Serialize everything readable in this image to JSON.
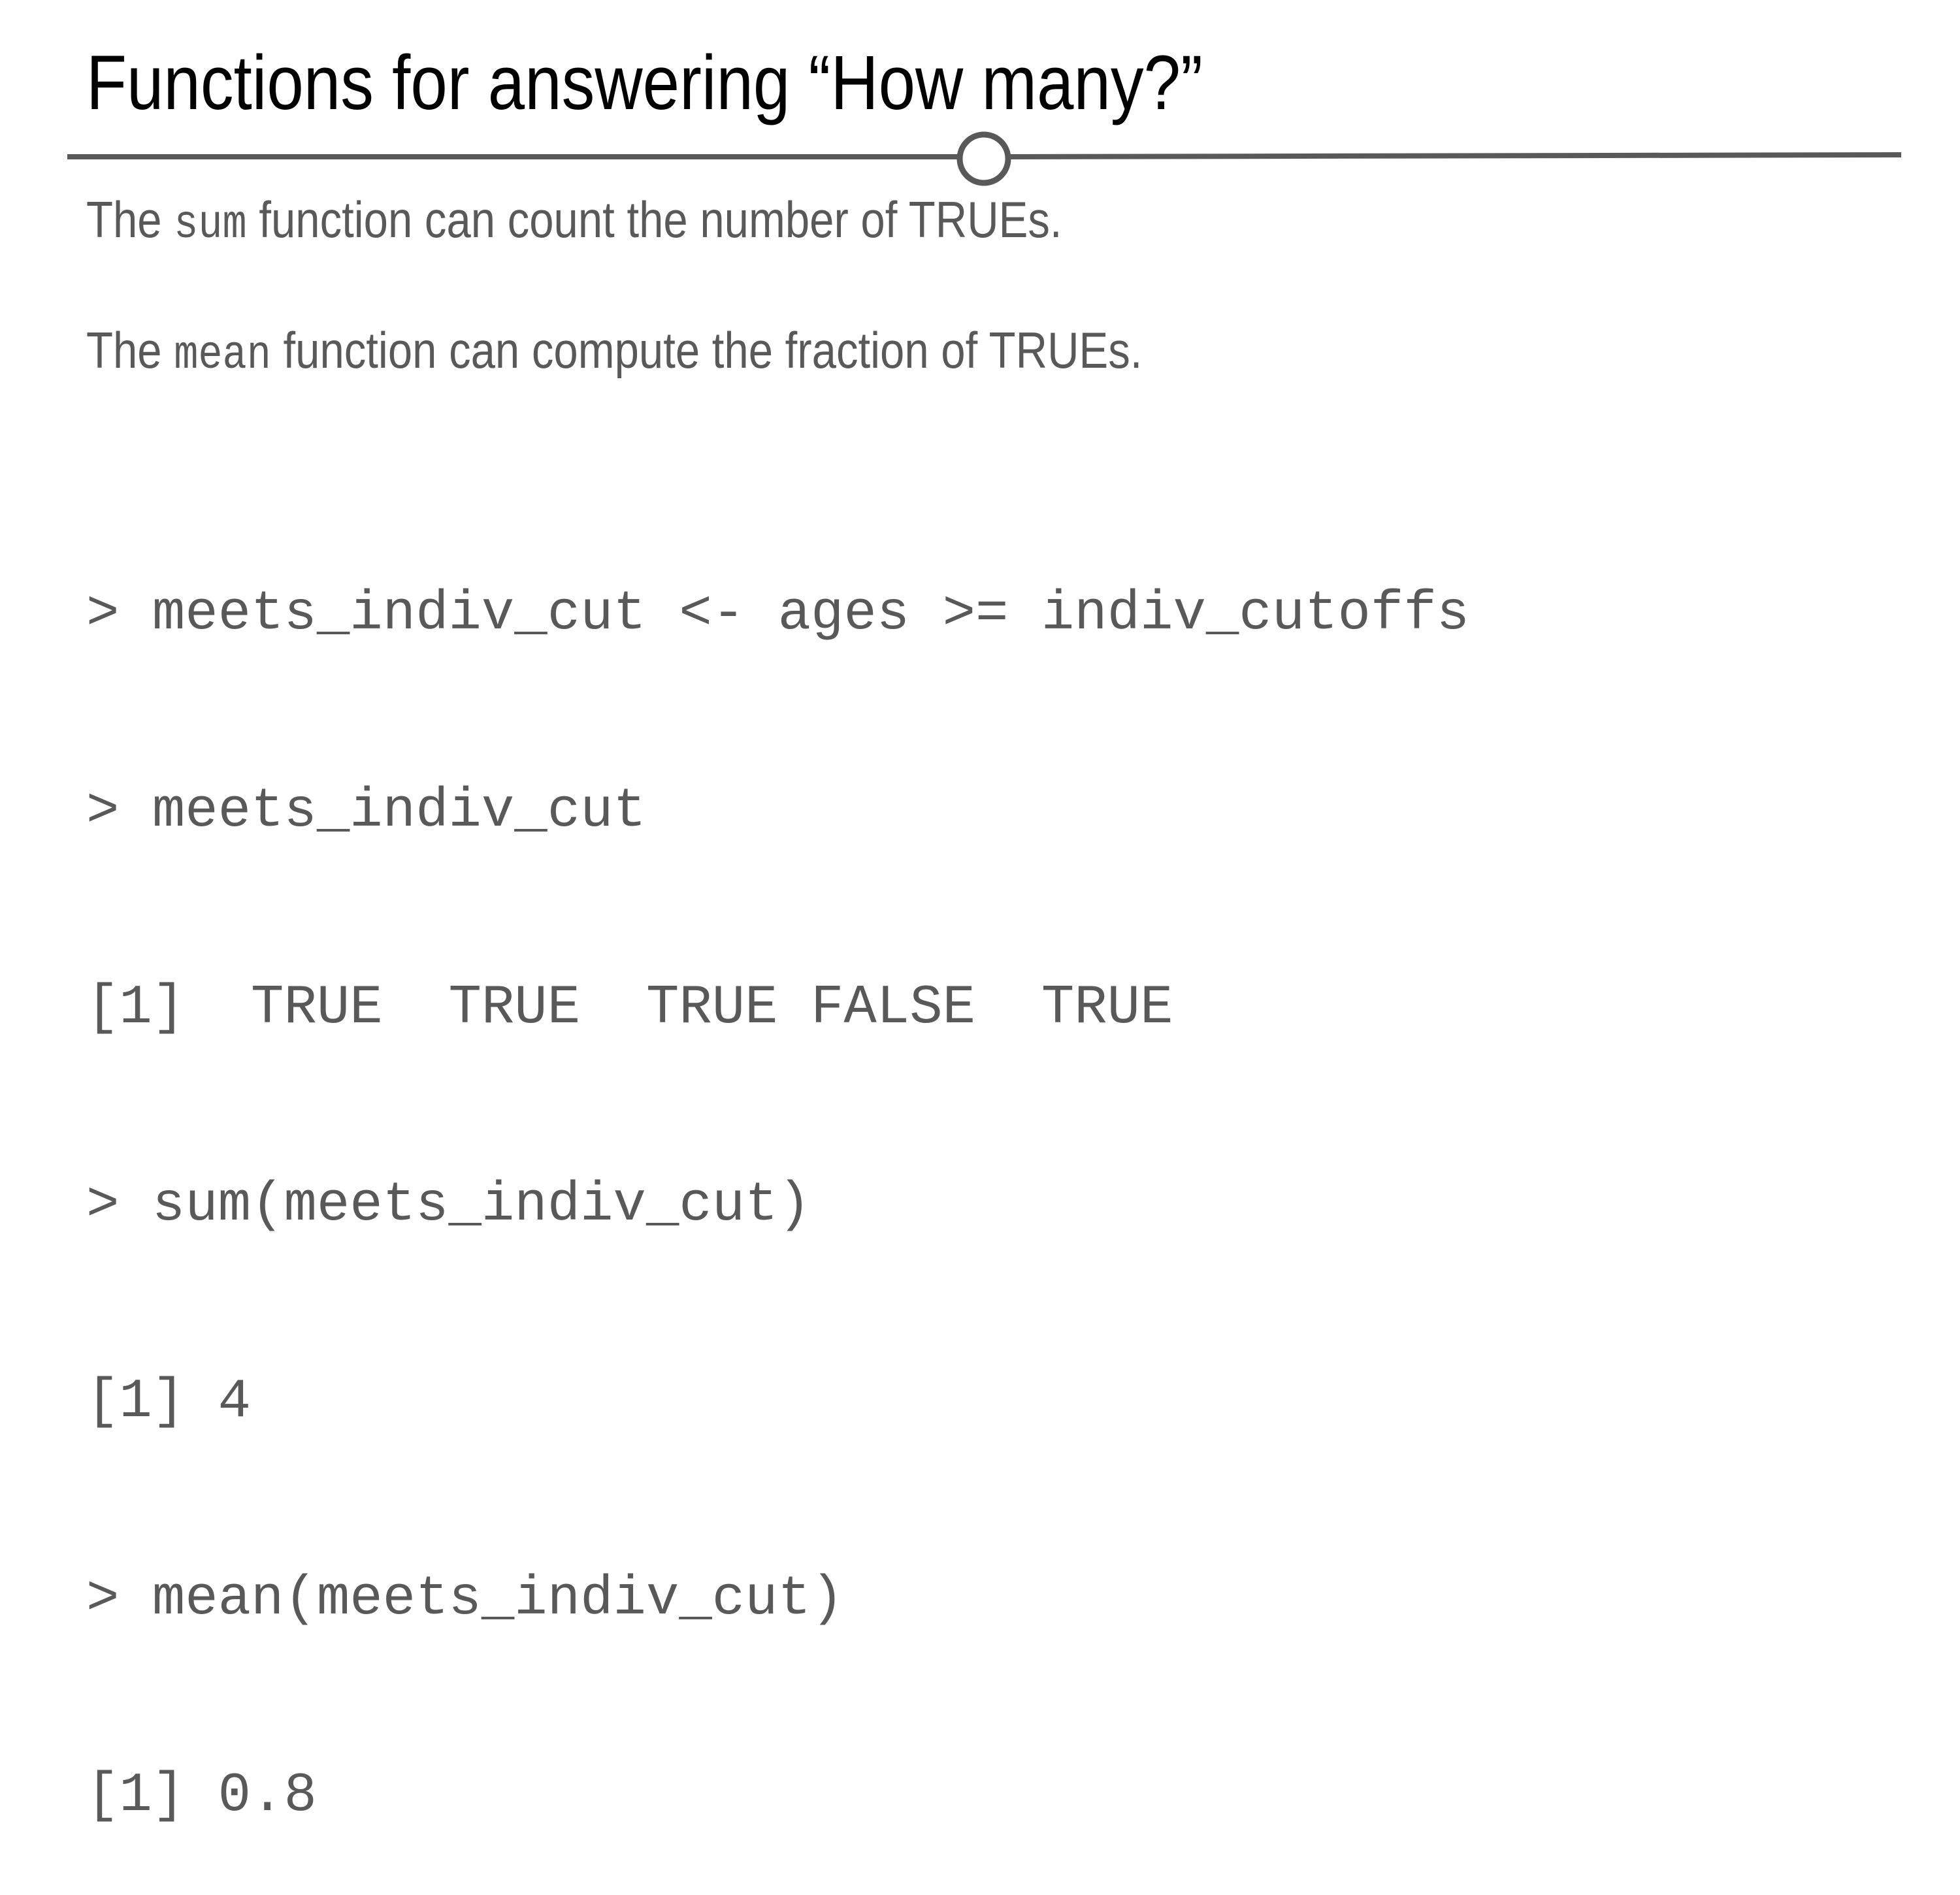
{
  "slide": {
    "title": "Functions for answering “How many?”",
    "line1": {
      "prefix": "The",
      "code": "sum",
      "suffix": "function can count the number of TRUEs."
    },
    "line2": {
      "prefix": "The",
      "code": "mean",
      "suffix": "function can compute the fraction of TRUEs."
    },
    "code_lines": [
      "> meets_indiv_cut <- ages >= indiv_cutoffs",
      "> meets_indiv_cut",
      "[1]  TRUE  TRUE  TRUE FALSE  TRUE",
      "> sum(meets_indiv_cut)",
      "[1] 4",
      "> mean(meets_indiv_cut)",
      "[1] 0.8"
    ]
  },
  "colors": {
    "title": "#000000",
    "body_text": "#595959",
    "divider": "#595959",
    "background": "#ffffff"
  }
}
